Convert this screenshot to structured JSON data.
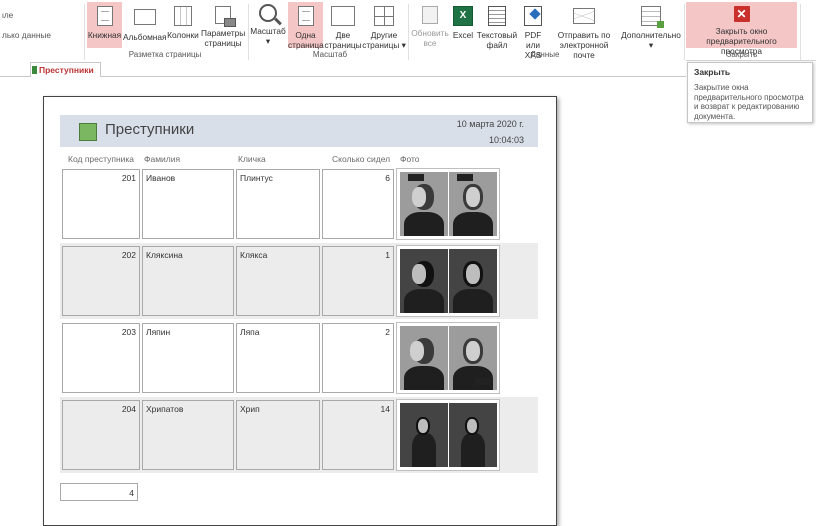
{
  "ribbon": {
    "left_cut": {
      "line1": "ιле",
      "line2": "лько данные"
    },
    "buttons": {
      "portrait": "Книжная",
      "landscape": "Альбомная",
      "columns": "Колонки",
      "page_setup_l1": "Параметры",
      "page_setup_l2": "страницы",
      "zoom_l1": "Масштаб",
      "zoom_l2": "▾",
      "one_page_l1": "Одна",
      "one_page_l2": "страница",
      "two_pages_l1": "Две",
      "two_pages_l2": "страницы",
      "more_pages_l1": "Другие",
      "more_pages_l2": "страницы ▾",
      "refresh_l1": "Обновить",
      "refresh_l2": "все",
      "excel": "Excel",
      "text_file_l1": "Текстовый",
      "text_file_l2": "файл",
      "pdf_l1": "PDF",
      "pdf_l2": "или XPS",
      "email_l1": "Отправить по",
      "email_l2": "электронной почте",
      "more_l1": "Дополнительно",
      "more_l2": "▾",
      "close_preview_l1": "Закрыть окно",
      "close_preview_l2": "предварительного просмотра"
    },
    "groups": {
      "page_layout": "Разметка страницы",
      "zoom": "Масштаб",
      "data": "Данные",
      "close": "Закрыть"
    }
  },
  "tab": {
    "label": "Преступники"
  },
  "tooltip": {
    "title": "Закрыть",
    "body": "Закрытие окна предварительного просмотра и возврат к редактированию документа."
  },
  "report": {
    "title": "Преступники",
    "date": "10 марта 2020 г.",
    "time": "10:04:03",
    "columns": {
      "code": "Код преступника",
      "surname": "Фамилия",
      "nickname": "Кличка",
      "served": "Сколько сидел",
      "photo": "Фото"
    },
    "rows": [
      {
        "code": "201",
        "surname": "Иванов",
        "nickname": "Плинтус",
        "served": "6"
      },
      {
        "code": "202",
        "surname": "Кляксина",
        "nickname": "Клякса",
        "served": "1"
      },
      {
        "code": "203",
        "surname": "Ляпин",
        "nickname": "Ляпа",
        "served": "2"
      },
      {
        "code": "204",
        "surname": "Хрипатов",
        "nickname": "Хрип",
        "served": "14"
      }
    ],
    "total_count": "4"
  },
  "colors": {
    "highlight": "#f4c6c6",
    "header_band": "#d8dfe9",
    "close_icon": "#c9302c",
    "tab_text": "#b33333"
  }
}
